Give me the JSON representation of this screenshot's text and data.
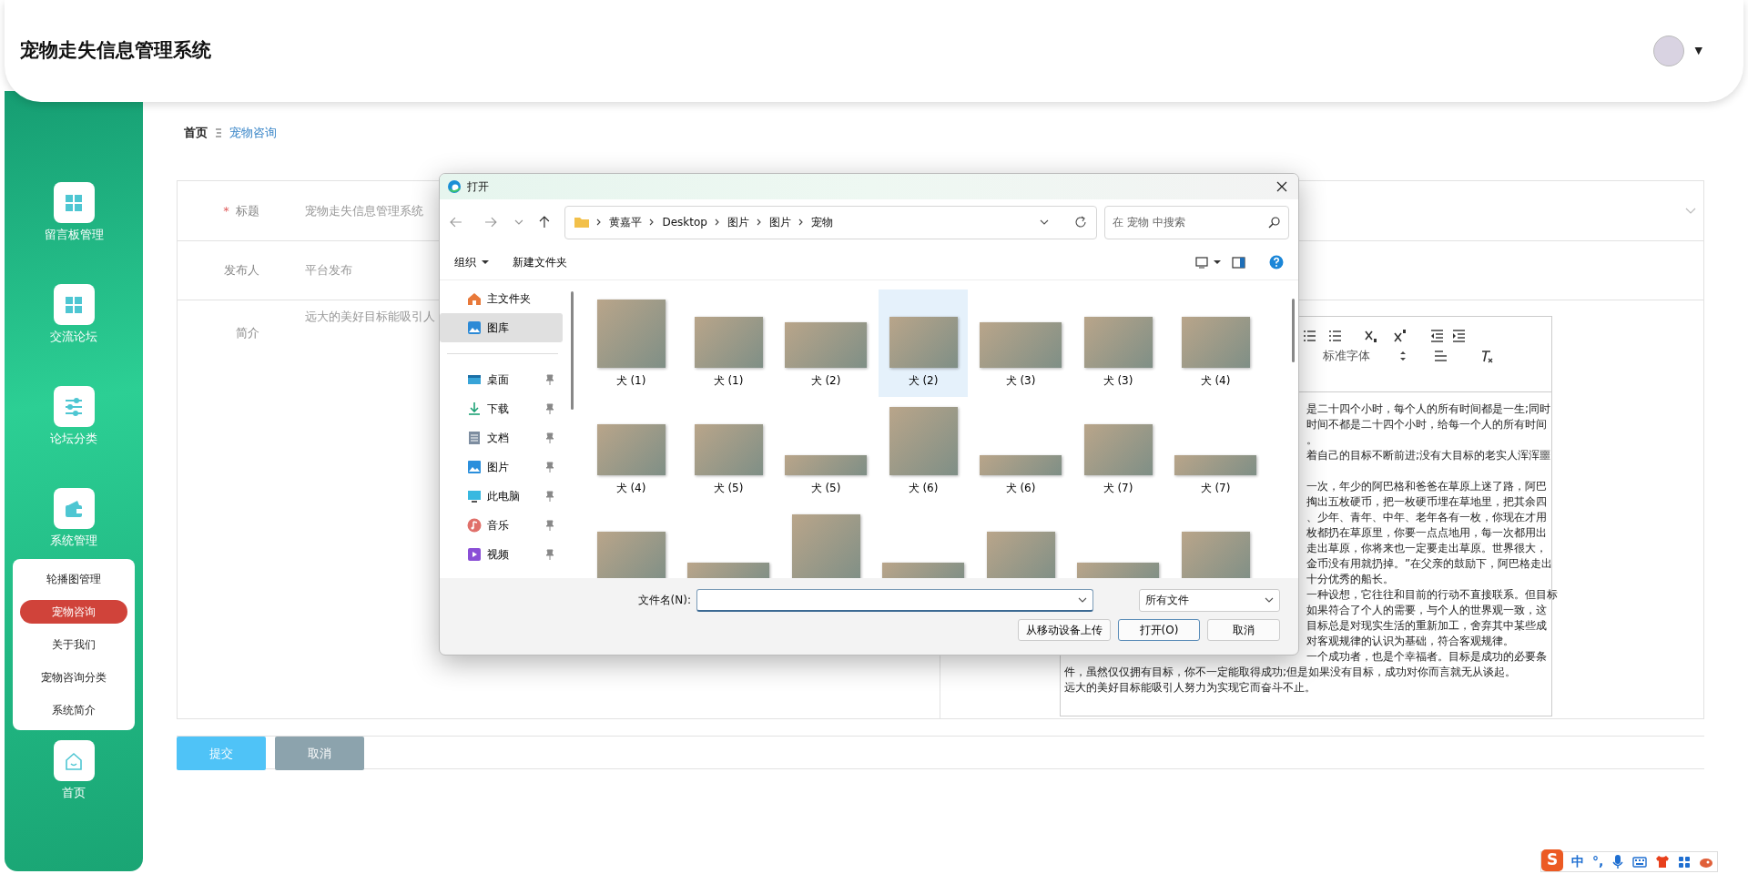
{
  "app": {
    "title": "宠物走失信息管理系统",
    "user_caret": "▼"
  },
  "sidebar": {
    "items": [
      {
        "label": "留言板管理",
        "kind": "grid"
      },
      {
        "label": "交流论坛",
        "kind": "grid"
      },
      {
        "label": "论坛分类",
        "kind": "sliders"
      },
      {
        "label": "系统管理",
        "kind": "wallet",
        "expanded": true,
        "children": [
          {
            "label": "轮播图管理",
            "selected": false
          },
          {
            "label": "宠物咨询",
            "selected": true
          },
          {
            "label": "关于我们",
            "selected": false
          },
          {
            "label": "宠物咨询分类",
            "selected": false
          },
          {
            "label": "系统简介",
            "selected": false
          }
        ]
      },
      {
        "label": "首页",
        "kind": "home"
      }
    ]
  },
  "breadcrumb": [
    {
      "label": "首页",
      "current": false
    },
    {
      "label": "宠物咨询",
      "current": true
    }
  ],
  "form": {
    "fields": [
      {
        "label": "标题",
        "required_mark": "*",
        "value": "宠物走失信息管理系统",
        "kind": "select"
      },
      {
        "label": "发布人",
        "value": "平台发布",
        "kind": "text"
      },
      {
        "label": "简介",
        "value": "远大的美好目标能吸引人",
        "kind": "rich"
      }
    ]
  },
  "editor": {
    "font_select": "标准字体",
    "lines": [
      {
        "text": "是二十四个小时，每个人的所有时间都是一生;同时",
        "covered": true,
        "space_before": false
      },
      {
        "text": "时间不都是二十四个小时，给每一个人的所有时间",
        "covered": true,
        "space_before": false
      },
      {
        "text": "。",
        "covered": true,
        "space_before": false
      },
      {
        "text": "着自己的目标不断前进;没有大目标的老实人浑浑噩",
        "covered": true,
        "space_before": false
      },
      {
        "text": "一次，年少的阿巴格和爸爸在草原上迷了路，阿巴",
        "covered": true,
        "space_before": true
      },
      {
        "text": "掏出五枚硬币，把一枚硬币埋在草地里，把其余四",
        "covered": true,
        "space_before": false
      },
      {
        "text": "、少年、青年、中年、老年各有一枚，你现在才用",
        "covered": true,
        "space_before": false
      },
      {
        "text": "枚都扔在草原里，你要一点点地用，每一次都用出",
        "covered": true,
        "space_before": false
      },
      {
        "text": "走出草原，你将来也一定要走出草原。世界很大，",
        "covered": true,
        "space_before": false
      },
      {
        "text": "金币没有用就扔掉。”在父亲的鼓励下，阿巴格走出",
        "covered": true,
        "space_before": false
      },
      {
        "text": "十分优秀的船长。",
        "covered": true,
        "space_before": false
      },
      {
        "text": "一种设想，它往往和目前的行动不直接联系。但目标",
        "covered": true,
        "space_before": false
      },
      {
        "text": "如果符合了个人的需要，与个人的世界观一致，这",
        "covered": true,
        "space_before": false
      },
      {
        "text": "目标总是对现实生活的重新加工，舍弃其中某些成",
        "covered": true,
        "space_before": false
      },
      {
        "text": "对客观规律的认识为基础，符合客观规律。",
        "covered": true,
        "space_before": false
      },
      {
        "text": "一个成功者，也是个幸福者。目标是成功的必要条",
        "covered": true,
        "space_before": false
      },
      {
        "text": "件，虽然仅仅拥有目标，你不一定能取得成功;但是如果没有目标，成功对你而言就无从谈起。",
        "covered": false,
        "space_before": false
      },
      {
        "text": "远大的美好目标能吸引人努力为实现它而奋斗不止。",
        "covered": false,
        "space_before": false
      }
    ]
  },
  "form_buttons": [
    {
      "label": "提交",
      "kind": "primary"
    },
    {
      "label": "取消",
      "kind": "secondary"
    }
  ],
  "dialog": {
    "title": "打开",
    "path": [
      "黄嘉平",
      "Desktop",
      "图片",
      "图片",
      "宠物"
    ],
    "search_placeholder": "在 宠物 中搜索",
    "commands": [
      {
        "label": "组织",
        "menu": true
      },
      {
        "label": "新建文件夹",
        "menu": false
      }
    ],
    "nav": [
      {
        "items": [
          {
            "label": "主文件夹",
            "kind": "home",
            "selected": false,
            "pinned": false
          },
          {
            "label": "图库",
            "kind": "gallery",
            "selected": true,
            "pinned": false
          }
        ]
      },
      {
        "items": [
          {
            "label": "桌面",
            "kind": "desktop",
            "selected": false,
            "pinned": true
          },
          {
            "label": "下载",
            "kind": "download",
            "selected": false,
            "pinned": true
          },
          {
            "label": "文档",
            "kind": "document",
            "selected": false,
            "pinned": true
          },
          {
            "label": "图片",
            "kind": "picture",
            "selected": false,
            "pinned": true
          },
          {
            "label": "此电脑",
            "kind": "computer",
            "selected": false,
            "pinned": true
          },
          {
            "label": "音乐",
            "kind": "music",
            "selected": false,
            "pinned": true
          },
          {
            "label": "视频",
            "kind": "video",
            "selected": false,
            "pinned": true
          }
        ]
      }
    ],
    "files": [
      {
        "label": "犬 (1)",
        "kind": "tall",
        "selected": false
      },
      {
        "label": "犬 (1)",
        "kind": "land",
        "selected": false
      },
      {
        "label": "犬 (2)",
        "kind": "wide",
        "selected": false
      },
      {
        "label": "犬 (2)",
        "kind": "land",
        "selected": true
      },
      {
        "label": "犬 (3)",
        "kind": "wide",
        "selected": false
      },
      {
        "label": "犬 (3)",
        "kind": "land",
        "selected": false
      },
      {
        "label": "犬 (4)",
        "kind": "land",
        "selected": false
      },
      {
        "label": "犬 (4)",
        "kind": "land",
        "selected": false
      },
      {
        "label": "犬 (5)",
        "kind": "land",
        "selected": false
      },
      {
        "label": "犬 (5)",
        "kind": "strip",
        "selected": false
      },
      {
        "label": "犬 (6)",
        "kind": "tall",
        "selected": false
      },
      {
        "label": "犬 (6)",
        "kind": "strip",
        "selected": false
      },
      {
        "label": "犬 (7)",
        "kind": "land",
        "selected": false
      },
      {
        "label": "犬 (7)",
        "kind": "strip",
        "selected": false
      },
      {
        "kind": "land",
        "selected": false
      },
      {
        "kind": "strip",
        "selected": false
      },
      {
        "kind": "tall",
        "selected": false
      },
      {
        "kind": "strip",
        "selected": false
      },
      {
        "kind": "land",
        "selected": false
      },
      {
        "kind": "strip",
        "selected": false
      },
      {
        "kind": "land",
        "selected": false
      }
    ],
    "filename_label": "文件名(N):",
    "filter": "所有文件",
    "buttons": [
      {
        "label": "从移动设备上传",
        "kind": "default"
      },
      {
        "label": "打开(O)",
        "kind": "primary"
      },
      {
        "label": "取消",
        "kind": "default"
      }
    ]
  },
  "ime_bar": {
    "logo": "S",
    "mode": "中",
    "punct": "°,"
  }
}
